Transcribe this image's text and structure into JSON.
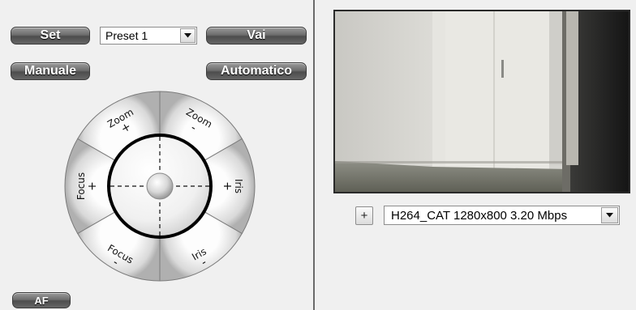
{
  "ptz": {
    "set_label": "Set",
    "preset_value": "Preset 1",
    "go_label": "Vai",
    "manual_label": "Manuale",
    "auto_label": "Automatico",
    "af_label": "AF"
  },
  "dial": {
    "zoom_in": {
      "word": "Zoom",
      "sign": "+"
    },
    "zoom_out": {
      "word": "Zoom",
      "sign": "-"
    },
    "focus_near": {
      "word": "Focus",
      "sign": "+"
    },
    "iris_open": {
      "word": "Iris",
      "sign": "+"
    },
    "focus_far": {
      "word": "Focus",
      "sign": "-"
    },
    "iris_close": {
      "word": "Iris",
      "sign": "-"
    }
  },
  "video": {
    "add_label": "+",
    "stream_value": "H264_CAT 1280x800 3.20 Mbps"
  },
  "icons": [
    "chevron-down-icon",
    "chevron-down-icon"
  ]
}
